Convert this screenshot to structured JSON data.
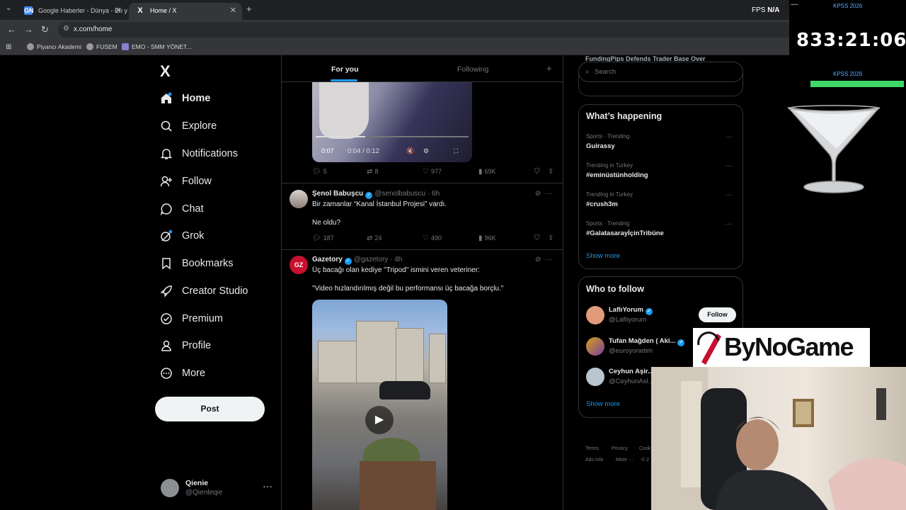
{
  "browser": {
    "tabs": [
      {
        "title": "Google Haberler - Dünya - En y",
        "favicon": "GN",
        "active": false
      },
      {
        "title": "Home / X",
        "favicon": "X",
        "active": true
      }
    ],
    "url": "x.com/home",
    "bookmarks": [
      "Piyancı Akademi",
      "FUSEM",
      "EMO - SMM YÖNET..."
    ],
    "fps_label": "FPS",
    "fps_value": "N/A"
  },
  "sidebar": {
    "logo": "X",
    "items": [
      {
        "label": "Home",
        "icon": "home-icon"
      },
      {
        "label": "Explore",
        "icon": "search-icon"
      },
      {
        "label": "Notifications",
        "icon": "bell-icon"
      },
      {
        "label": "Follow",
        "icon": "person-add-icon"
      },
      {
        "label": "Chat",
        "icon": "chat-icon"
      },
      {
        "label": "Grok",
        "icon": "grok-icon"
      },
      {
        "label": "Bookmarks",
        "icon": "bookmark-icon"
      },
      {
        "label": "Creator Studio",
        "icon": "rocket-icon"
      },
      {
        "label": "Premium",
        "icon": "premium-icon"
      },
      {
        "label": "Profile",
        "icon": "person-icon"
      },
      {
        "label": "More",
        "icon": "more-circle-icon"
      }
    ],
    "post_label": "Post",
    "account": {
      "name": "Qienie",
      "handle": "@Qienleqie"
    }
  },
  "feed": {
    "tabs": [
      "For you",
      "Following"
    ],
    "top_video": {
      "time_elapsed": "0:07",
      "time": "0:04 / 0:12"
    },
    "top_actions": {
      "replies": "5",
      "reposts": "8",
      "likes": "977",
      "views": "69K"
    },
    "tweets": [
      {
        "name": "Şenol Babuşcu",
        "handle": "@senolbabuscu",
        "time": "6h",
        "lines": [
          "Bir zamanlar “Kanal İstanbul Projesi” vardı.",
          "Ne oldu?"
        ],
        "replies": "187",
        "reposts": "24",
        "likes": "490",
        "views": "96K"
      },
      {
        "name": "Gazetory",
        "handle": "@gazetory",
        "time": "4h",
        "lines": [
          "Üç bacağı olan kediye \"Tripod\" ismini veren veteriner:",
          "\"Video hızlandırılmış değil bu performansı üç bacağa borçlu.\""
        ],
        "avatar_text": "GZ"
      }
    ]
  },
  "right": {
    "search_placeholder": "Search",
    "partial_heading": "FundingPips Defends Trader Base Over",
    "trending_title": "What’s happening",
    "trends": [
      {
        "meta": "Sports · Trending",
        "name": "Guirassy"
      },
      {
        "meta": "Trending in Turkey",
        "name": "#eminüstünholding"
      },
      {
        "meta": "Trending in Turkey",
        "name": "#crush3m"
      },
      {
        "meta": "Sports · Trending",
        "name": "#GalatasarayİçinTribüne"
      }
    ],
    "show_more": "Show more",
    "who_title": "Who to follow",
    "who": [
      {
        "name": "LaflıYorum",
        "handle": "@Lafliyorum",
        "button": "Follow"
      },
      {
        "name": "Tufan Mağden ( Aki...",
        "handle": "@euroyonetim"
      },
      {
        "name": "Ceyhun Aşir...",
        "handle": "@CeyhunAsl..."
      }
    ],
    "footer": [
      "Terms",
      "Privacy",
      "Cook",
      "Ads info",
      "More ···",
      "© 2"
    ]
  },
  "overlay": {
    "timer_label_top": "KPSS 2026",
    "timer_label_bottom": "KPSS 2026",
    "timer": "833:21:06",
    "brand": "ByNoGame"
  },
  "colors": {
    "accent": "#1d9bf0",
    "bg": "#000000",
    "border": "#2f3336",
    "muted": "#71767b",
    "timer_bar": "#3fd96a"
  }
}
